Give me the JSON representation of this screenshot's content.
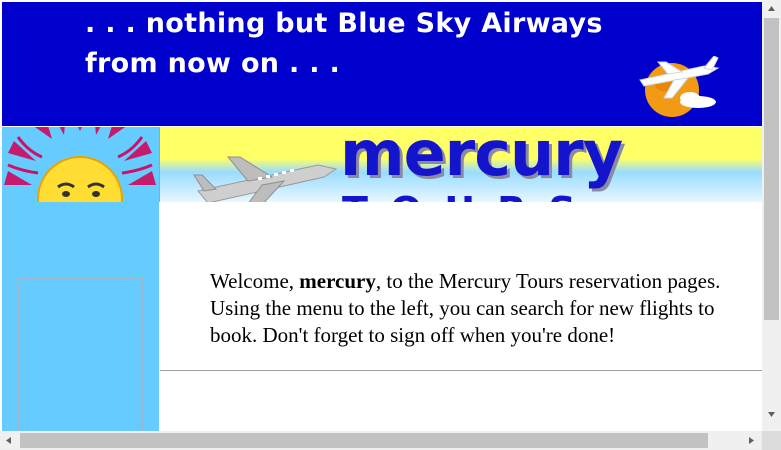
{
  "banner": {
    "line1": ". . . nothing but Blue Sky Airways",
    "line2": "from now on . . .",
    "background": "#0000cc"
  },
  "logo": {
    "brand": "mercury",
    "sub": "TOURS",
    "color": "#1414cc"
  },
  "welcome": {
    "prefix": "Welcome, ",
    "username": "mercury",
    "suffix": ", to the Mercury Tours reservation pages. Using the menu to the left, you can search for new flights to book. Don't forget to sign off when you're done!"
  },
  "colors": {
    "sidebar": "#66ccff",
    "scroll_thumb": "#c2c2c2"
  },
  "icons": {
    "globe": "globe-plane-icon",
    "sun": "sun-icon",
    "plane": "airplane-icon"
  }
}
